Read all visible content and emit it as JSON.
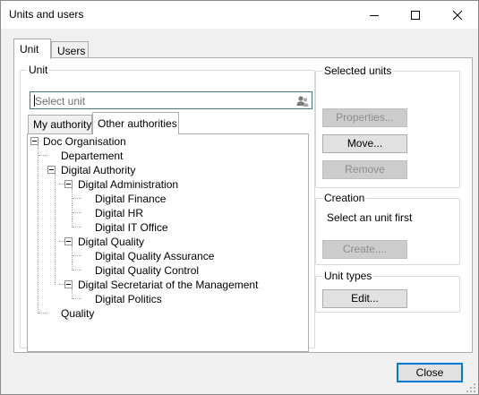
{
  "window": {
    "title": "Units and users"
  },
  "tabs": [
    {
      "label": "Unit",
      "active": true
    },
    {
      "label": "Users",
      "active": false
    }
  ],
  "unit_group": {
    "legend": "Unit",
    "search_placeholder": "Select unit",
    "subtabs": [
      {
        "label": "My authority",
        "active": false
      },
      {
        "label": "Other authorities",
        "active": true
      }
    ]
  },
  "tree": [
    {
      "label": "Doc Organisation",
      "level": 0,
      "expanded": true
    },
    {
      "label": "Departement",
      "level": 1
    },
    {
      "label": "Digital Authority",
      "level": 1,
      "expanded": true
    },
    {
      "label": "Digital Administration",
      "level": 2,
      "expanded": true
    },
    {
      "label": "Digital Finance",
      "level": 3
    },
    {
      "label": "Digital HR",
      "level": 3
    },
    {
      "label": "Digital IT Office",
      "level": 3
    },
    {
      "label": "Digital Quality",
      "level": 2,
      "expanded": true
    },
    {
      "label": "Digital Quality Assurance",
      "level": 3
    },
    {
      "label": "Digital Quality Control",
      "level": 3
    },
    {
      "label": "Digital Secretariat of the Management",
      "level": 2,
      "expanded": true
    },
    {
      "label": "Digital Politics",
      "level": 3
    },
    {
      "label": "Quality",
      "level": 1
    }
  ],
  "selected_units": {
    "legend": "Selected units",
    "properties_label": "Properties...",
    "move_label": "Move...",
    "remove_label": "Remove"
  },
  "creation": {
    "legend": "Creation",
    "info": "Select an unit first",
    "create_label": "Create...."
  },
  "unit_types": {
    "legend": "Unit types",
    "edit_label": "Edit..."
  },
  "footer": {
    "close_label": "Close"
  },
  "icons": {
    "minimize": "minimize-icon",
    "maximize": "maximize-icon",
    "close": "close-icon",
    "search": "users-search-icon",
    "resize": "resize-grip-icon"
  },
  "colors": {
    "accent": "#0078d7",
    "search_border": "#3b7a7a",
    "disabled_text": "#8d8d8d"
  }
}
